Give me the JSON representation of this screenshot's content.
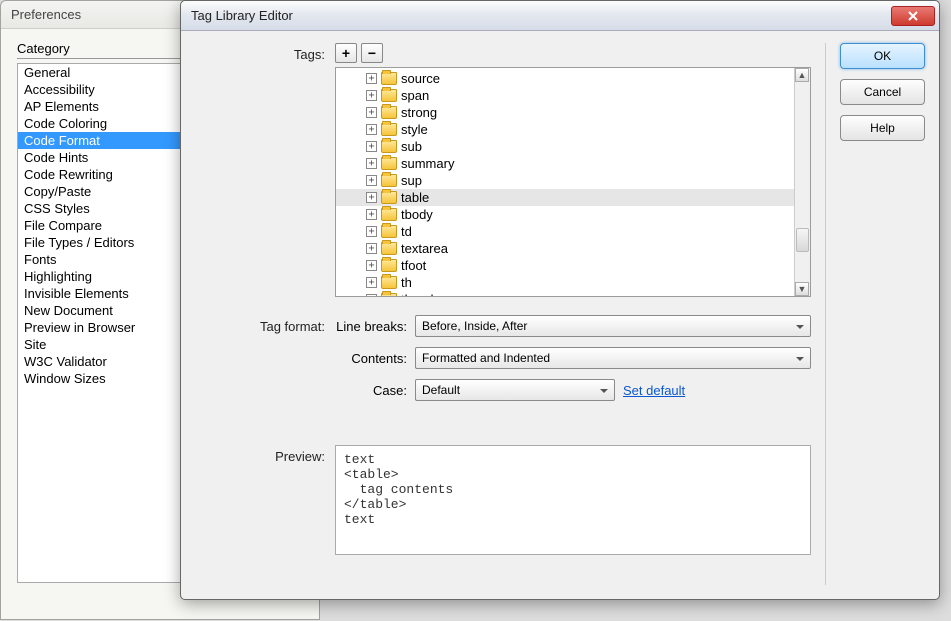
{
  "prefs": {
    "window_title": "Preferences",
    "category_heading": "Category",
    "categories": [
      "General",
      "Accessibility",
      "AP Elements",
      "Code Coloring",
      "Code Format",
      "Code Hints",
      "Code Rewriting",
      "Copy/Paste",
      "CSS Styles",
      "File Compare",
      "File Types / Editors",
      "Fonts",
      "Highlighting",
      "Invisible Elements",
      "New Document",
      "Preview in Browser",
      "Site",
      "W3C Validator",
      "Window Sizes"
    ],
    "selected_category": "Code Format"
  },
  "dialog": {
    "title": "Tag Library Editor",
    "buttons": {
      "ok": "OK",
      "cancel": "Cancel",
      "help": "Help"
    },
    "labels": {
      "tags": "Tags:",
      "tag_format": "Tag format:",
      "line_breaks": "Line breaks:",
      "contents": "Contents:",
      "case": "Case:",
      "preview": "Preview:",
      "set_default": "Set default"
    },
    "tag_tree": [
      "source",
      "span",
      "strong",
      "style",
      "sub",
      "summary",
      "sup",
      "table",
      "tbody",
      "td",
      "textarea",
      "tfoot",
      "th",
      "thead"
    ],
    "selected_tag": "table",
    "values": {
      "line_breaks": "Before, Inside, After",
      "contents": "Formatted and Indented",
      "case": "Default"
    },
    "preview_text": "text\n<table>\n  tag contents\n</table>\ntext"
  }
}
